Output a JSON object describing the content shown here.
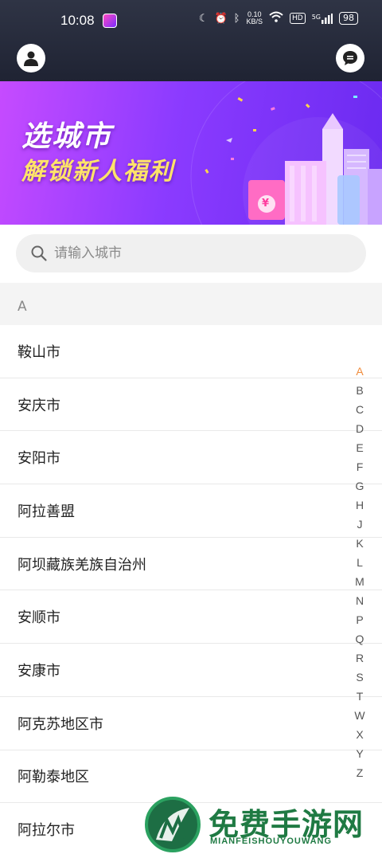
{
  "status_bar": {
    "time": "10:08",
    "net_speed_value": "0.10",
    "net_speed_unit": "KB/S",
    "hd_label": "HD",
    "signal_label": "5G",
    "battery": "98"
  },
  "banner": {
    "title_line1": "选城市",
    "title_line2": "解锁新人福利",
    "coin_symbol": "¥"
  },
  "search": {
    "placeholder": "请输入城市"
  },
  "section": {
    "letter": "A"
  },
  "cities": [
    "鞍山市",
    "安庆市",
    "安阳市",
    "阿拉善盟",
    "阿坝藏族羌族自治州",
    "安顺市",
    "安康市",
    "阿克苏地区市",
    "阿勒泰地区",
    "阿拉尔市"
  ],
  "alphabet_index": [
    "A",
    "B",
    "C",
    "D",
    "E",
    "F",
    "G",
    "H",
    "J",
    "K",
    "L",
    "M",
    "N",
    "P",
    "Q",
    "R",
    "S",
    "T",
    "W",
    "X",
    "Y",
    "Z"
  ],
  "active_index_letter": "A",
  "watermark": {
    "title": "免费手游网",
    "subtitle": "MIANFEISHOUYOUWANG"
  },
  "colors": {
    "header_bg": "#2a2f40",
    "banner_start": "#c64bff",
    "banner_end": "#6a2af0",
    "index_active": "#f08c3c"
  }
}
